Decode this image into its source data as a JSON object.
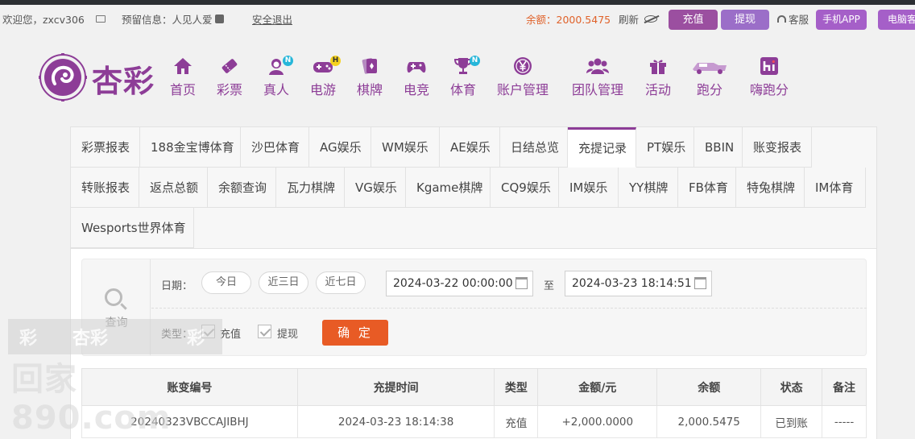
{
  "topbar": {
    "welcome": "欢迎您，zxcv306",
    "reserve": "预留信息：人见人爱",
    "logout": "安全退出",
    "balance": "余额：2000.5475",
    "refresh": "刷新",
    "recharge": "充值",
    "withdraw": "提现",
    "service": "客服",
    "mobile_app": "手机APP",
    "pc_client": "电脑客"
  },
  "logo": {
    "text": "杏彩"
  },
  "nav": [
    {
      "label": "首页",
      "icon": "home-icon"
    },
    {
      "label": "彩票",
      "icon": "lottery-ticket-icon"
    },
    {
      "label": "真人",
      "icon": "live-dealer-icon",
      "badge": "N"
    },
    {
      "label": "电游",
      "icon": "gamepad-icon",
      "badge": "H"
    },
    {
      "label": "棋牌",
      "icon": "cards-icon"
    },
    {
      "label": "电竞",
      "icon": "esports-controller-icon"
    },
    {
      "label": "体育",
      "icon": "trophy-icon",
      "badge": "N"
    },
    {
      "label": "账户管理",
      "icon": "yen-coin-icon"
    },
    {
      "label": "团队管理",
      "icon": "team-icon"
    },
    {
      "label": "活动",
      "icon": "gift-icon"
    },
    {
      "label": "跑分",
      "icon": "race-car-icon"
    },
    {
      "label": "嗨跑分",
      "icon": "hi-icon"
    }
  ],
  "tabs": {
    "row1": [
      "彩票报表",
      "188金宝博体育",
      "沙巴体育",
      "AG娱乐",
      "WM娱乐",
      "AE娱乐",
      "日结总览",
      "充提记录",
      "PT娱乐",
      "BBIN",
      "账变报表"
    ],
    "row2": [
      "转账报表",
      "返点总额",
      "余额查询",
      "瓦力棋牌",
      "VG娱乐",
      "Kgame棋牌",
      "CQ9娱乐",
      "IM娱乐",
      "YY棋牌",
      "FB体育",
      "特兔棋牌",
      "IM体育"
    ],
    "row3": [
      "Wesports世界体育"
    ],
    "active": "充提记录"
  },
  "filter": {
    "query_label": "查询",
    "date_label": "日期：",
    "quick": [
      "今日",
      "近三日",
      "近七日"
    ],
    "start": "2024-03-22 00:00:00",
    "to": "至",
    "end": "2024-03-23 18:14:51",
    "type_label": "类型：",
    "types": [
      "充值",
      "提现"
    ],
    "confirm": "确 定"
  },
  "table": {
    "headers": [
      "账变编号",
      "充提时间",
      "类型",
      "金额/元",
      "余额",
      "状态",
      "备注"
    ],
    "rows": [
      [
        "20240323VBCCAJIBHJ",
        "2024-03-23 18:14:38",
        "充值",
        "+2,000.0000",
        "2,000.5475",
        "已到账",
        "-----"
      ]
    ]
  },
  "watermark": {
    "text": "回家890.com",
    "top_glyphs": [
      "彩",
      "杏彩",
      "彩"
    ]
  },
  "colors": {
    "brand": "#8d3d97",
    "accent": "#e85b25",
    "amount": "#d4161e",
    "status_ok": "#2aa52a",
    "balance": "#e0622a"
  }
}
